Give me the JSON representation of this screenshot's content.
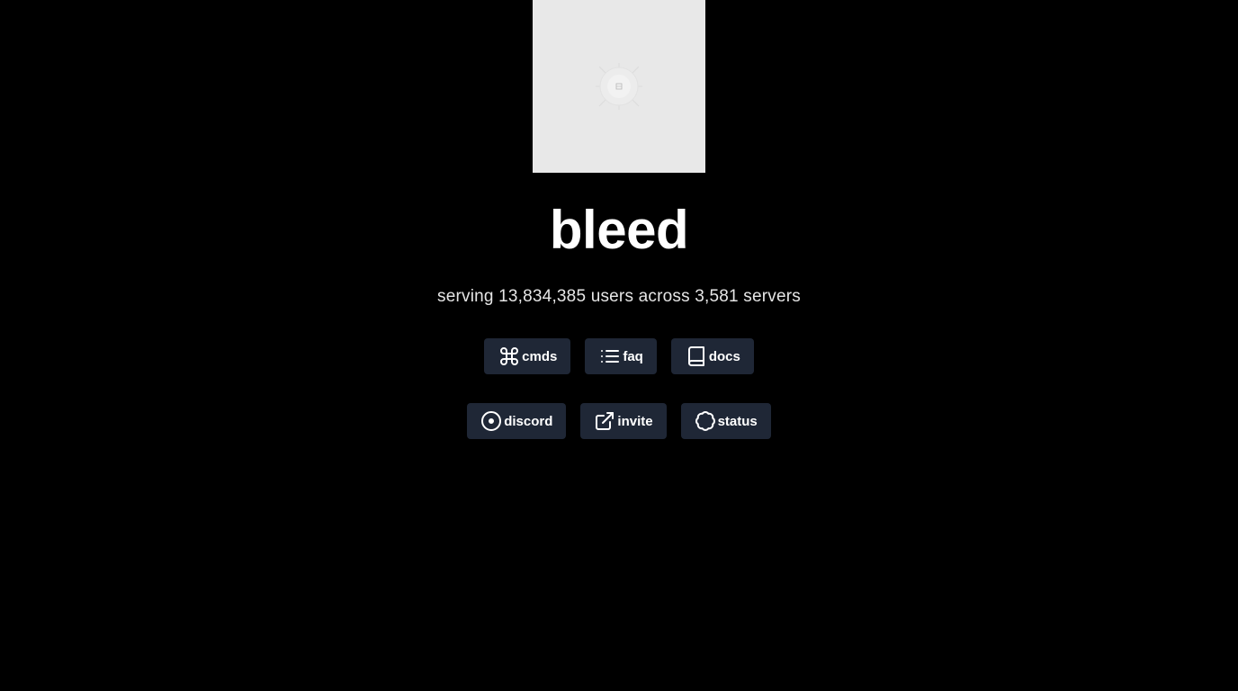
{
  "app": {
    "title": "bleed",
    "stats_text": "serving 13,834,385 users across 3,581 servers"
  },
  "logo": {
    "icon": "broken-image-icon",
    "background": "#e8e8e8"
  },
  "nav_primary": [
    {
      "label": "cmds",
      "icon": "command-icon"
    },
    {
      "label": "faq",
      "icon": "list-icon"
    },
    {
      "label": "docs",
      "icon": "book-icon"
    }
  ],
  "nav_secondary": [
    {
      "label": "discord",
      "icon": "disc-icon"
    },
    {
      "label": "invite",
      "icon": "external-link-icon"
    },
    {
      "label": "status",
      "icon": "badge-icon"
    }
  ],
  "colors": {
    "background": "#000000",
    "button_bg": "#1f2736",
    "text": "#ffffff"
  }
}
